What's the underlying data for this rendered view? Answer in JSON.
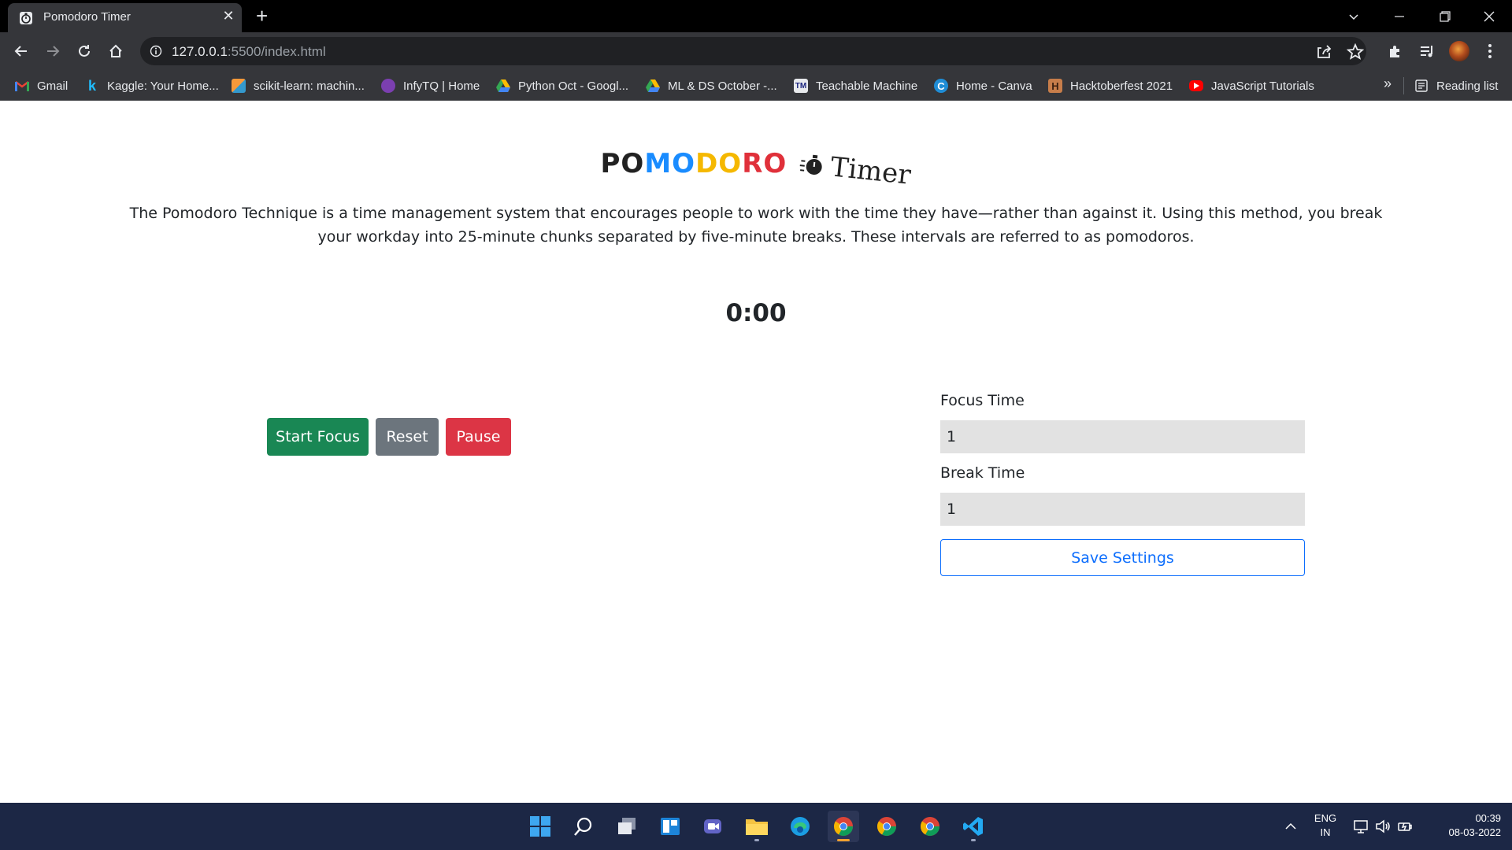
{
  "browser": {
    "tab_title": "Pomodoro Timer",
    "tab_close": "✕",
    "new_tab": "+",
    "url_host": "127.0.0.1",
    "url_rest": ":5500/index.html",
    "bookmarks": [
      {
        "label": "Gmail",
        "icon": "gmail-icon"
      },
      {
        "label": "Kaggle: Your Home...",
        "icon": "kaggle-icon"
      },
      {
        "label": "scikit-learn: machin...",
        "icon": "scikit-learn-icon"
      },
      {
        "label": "InfyTQ | Home",
        "icon": "infytq-icon"
      },
      {
        "label": "Python Oct - Googl...",
        "icon": "google-drive-icon"
      },
      {
        "label": "ML & DS October -...",
        "icon": "google-drive-icon"
      },
      {
        "label": "Teachable Machine",
        "icon": "teachable-machine-icon"
      },
      {
        "label": "Home - Canva",
        "icon": "canva-icon"
      },
      {
        "label": "Hacktoberfest 2021",
        "icon": "hacktoberfest-icon"
      },
      {
        "label": "JavaScript Tutorials",
        "icon": "youtube-icon"
      }
    ],
    "bookmarks_more": "»",
    "reading_list": "Reading list"
  },
  "page": {
    "brand": {
      "p1": "PO",
      "p2": "MO",
      "p3": "DO",
      "p4": "RO",
      "timer": "Timer"
    },
    "intro": "The Pomodoro Technique is a time management system that encourages people to work with the time they have—rather than against it. Using this method, you break your workday into 25-minute chunks separated by five-minute breaks. These intervals are referred to as pomodoros.",
    "timer_display": "0:00",
    "buttons": {
      "start": "Start Focus",
      "reset": "Reset",
      "pause": "Pause"
    },
    "settings": {
      "focus_label": "Focus Time",
      "focus_value": "1",
      "break_label": "Break Time",
      "break_value": "1",
      "save": "Save Settings"
    }
  },
  "taskbar": {
    "lang_line1": "ENG",
    "lang_line2": "IN",
    "time": "00:39",
    "date": "08-03-2022"
  },
  "colors": {
    "start": "#198754",
    "reset": "#6c757d",
    "pause": "#dc3545",
    "save": "#0d6efd"
  }
}
